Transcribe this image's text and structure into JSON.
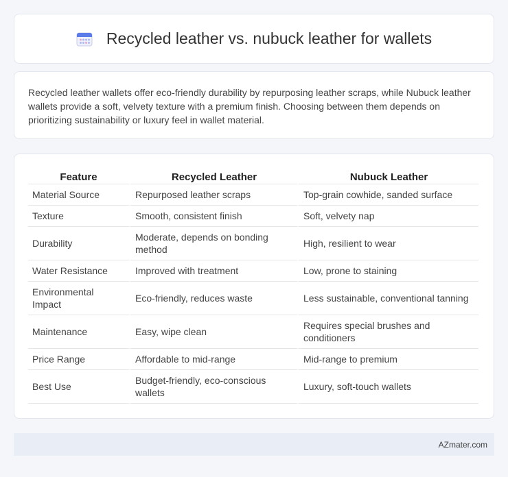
{
  "header": {
    "title": "Recycled leather vs. nubuck leather for wallets",
    "icon": "calendar-icon"
  },
  "intro": {
    "text": "Recycled leather wallets offer eco-friendly durability by repurposing leather scraps, while Nubuck leather wallets provide a soft, velvety texture with a premium finish. Choosing between them depends on prioritizing sustainability or luxury feel in wallet material."
  },
  "table": {
    "headers": [
      "Feature",
      "Recycled Leather",
      "Nubuck Leather"
    ],
    "rows": [
      [
        "Material Source",
        "Repurposed leather scraps",
        "Top-grain cowhide, sanded surface"
      ],
      [
        "Texture",
        "Smooth, consistent finish",
        "Soft, velvety nap"
      ],
      [
        "Durability",
        "Moderate, depends on bonding method",
        "High, resilient to wear"
      ],
      [
        "Water Resistance",
        "Improved with treatment",
        "Low, prone to staining"
      ],
      [
        "Environmental Impact",
        "Eco-friendly, reduces waste",
        "Less sustainable, conventional tanning"
      ],
      [
        "Maintenance",
        "Easy, wipe clean",
        "Requires special brushes and conditioners"
      ],
      [
        "Price Range",
        "Affordable to mid-range",
        "Mid-range to premium"
      ],
      [
        "Best Use",
        "Budget-friendly, eco-conscious wallets",
        "Luxury, soft-touch wallets"
      ]
    ]
  },
  "footer": {
    "site": "AZmater.com"
  }
}
